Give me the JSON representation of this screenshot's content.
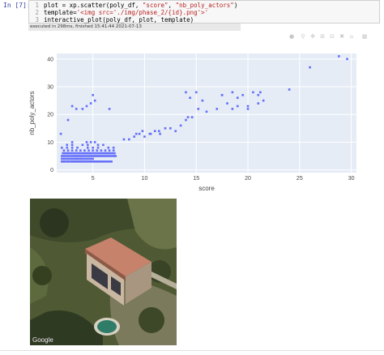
{
  "cell": {
    "prompt": "In [7]:",
    "lines": [
      {
        "num": "1",
        "parts": [
          {
            "t": "plot = xp.scatter(poly_df, ",
            "c": "tok-fn"
          },
          {
            "t": "\"score\"",
            "c": "tok-str"
          },
          {
            "t": ", ",
            "c": "tok-fn"
          },
          {
            "t": "\"nb_poly_actors\"",
            "c": "tok-str"
          },
          {
            "t": ")",
            "c": "tok-fn"
          }
        ]
      },
      {
        "num": "2",
        "parts": [
          {
            "t": "template=",
            "c": "tok-fn"
          },
          {
            "t": "'<img src='./img/phase_2/{id}.png'>'",
            "c": "tok-str"
          }
        ]
      },
      {
        "num": "3",
        "parts": [
          {
            "t": "interactive_plot(poly_df, plot, template)",
            "c": "tok-fn"
          }
        ]
      }
    ],
    "status": "executed in 298ms, finished 15:41:44 2021-07-13"
  },
  "toolbar": {
    "icons": [
      "camera-icon",
      "zoom-icon",
      "pan-icon",
      "zoom-in-icon",
      "zoom-out-icon",
      "autoscale-icon",
      "reset-axes-icon",
      "plotly-logo-icon"
    ]
  },
  "map": {
    "attribution": "Google"
  },
  "chart_data": {
    "type": "scatter",
    "xlabel": "score",
    "ylabel": "nb_poly_actors",
    "xlim": [
      1.5,
      30.5
    ],
    "ylim": [
      -1,
      42
    ],
    "xticks": [
      5,
      10,
      15,
      20,
      25,
      30
    ],
    "yticks": [
      0,
      10,
      20,
      30,
      40
    ],
    "colors": {
      "marker": "#636efa",
      "plot_bg": "#e5ecf6",
      "grid": "#ffffff"
    },
    "x": [
      2,
      2.2,
      2.4,
      2.6,
      2.8,
      3,
      3.2,
      3.4,
      3.6,
      3.8,
      4,
      4.2,
      4.4,
      4.6,
      4.8,
      5,
      5.2,
      5.4,
      5.6,
      5.8,
      6,
      6.2,
      6.4,
      6.6,
      6.8,
      2,
      2.2,
      2.4,
      2.6,
      2.8,
      3,
      3.2,
      3.4,
      3.6,
      3.8,
      4,
      4.2,
      4.4,
      4.6,
      4.8,
      5,
      2,
      2.2,
      2.4,
      2.6,
      2.8,
      3,
      3.2,
      3.4,
      3.6,
      3.8,
      4,
      4.2,
      4.4,
      4.6,
      4.8,
      5,
      5.2,
      5.4,
      5.6,
      5.8,
      6,
      6.2,
      6.4,
      6.6,
      6.8,
      7,
      7.2,
      2.1,
      2.3,
      2.5,
      2.7,
      2.9,
      3.1,
      3.3,
      3.5,
      3.7,
      3.9,
      4.1,
      4.3,
      4.5,
      4.7,
      4.9,
      5.1,
      5.3,
      5.5,
      5.7,
      5.9,
      6.1,
      6.3,
      6.5,
      6.7,
      6.9,
      7.1,
      2.2,
      2.6,
      3,
      3.4,
      3.8,
      4.2,
      4.6,
      5,
      5.4,
      5.8,
      6.2,
      6.6,
      7,
      2,
      2.5,
      3,
      3.5,
      4.5,
      5,
      5.5,
      6.5,
      7,
      2.5,
      3,
      4,
      4.5,
      5.5,
      6,
      3,
      4.4,
      4.8,
      5.2,
      1.9,
      2.6,
      3,
      3.4,
      4,
      4.4,
      4.8,
      5,
      5.2,
      6.6,
      8,
      8.5,
      9,
      9.5,
      10,
      10.5,
      11,
      11.5,
      12,
      12.5,
      13,
      13.5,
      9.2,
      9.8,
      10.6,
      11.4,
      14,
      14.2,
      14.4,
      14.6,
      15,
      15.2,
      15.6,
      14,
      16,
      17,
      17.5,
      18,
      18.5,
      19,
      19.5,
      20,
      20.5,
      21,
      21.2,
      21.5,
      17.5,
      18.5,
      19,
      20,
      21,
      24,
      26,
      28.8,
      29.6
    ],
    "y": [
      3,
      3,
      3,
      3,
      3,
      3,
      3,
      3,
      3,
      3,
      3,
      3,
      3,
      3,
      3,
      3,
      3,
      3,
      3,
      3,
      3,
      3,
      3,
      3,
      3,
      4,
      4,
      4,
      4,
      4,
      4,
      4,
      4,
      4,
      4,
      4,
      4,
      4,
      4,
      4,
      4,
      5,
      5,
      5,
      5,
      5,
      5,
      5,
      5,
      5,
      5,
      5,
      5,
      5,
      5,
      5,
      5,
      5,
      5,
      5,
      5,
      5,
      5,
      5,
      5,
      5,
      5,
      5,
      6,
      6,
      6,
      6,
      6,
      6,
      6,
      6,
      6,
      6,
      6,
      6,
      6,
      6,
      6,
      6,
      6,
      6,
      6,
      6,
      6,
      6,
      6,
      6,
      6,
      6,
      7,
      7,
      7,
      7,
      7,
      7,
      7,
      7,
      7,
      7,
      7,
      7,
      7,
      8,
      8,
      8,
      8,
      8,
      8,
      8,
      8,
      8,
      9,
      9,
      9,
      9,
      9,
      9,
      10,
      10,
      10,
      10,
      13,
      18,
      23,
      22,
      22,
      23,
      24,
      27,
      25,
      22,
      11,
      11,
      12,
      13,
      12,
      13,
      14,
      13,
      15,
      15,
      14,
      16,
      13,
      14,
      13,
      14,
      18,
      19,
      26,
      19,
      28,
      22,
      25,
      28,
      21,
      22,
      27,
      24,
      28,
      23,
      27,
      22,
      28,
      24,
      28,
      25,
      27,
      22,
      26,
      23,
      27,
      29,
      37,
      41,
      40
    ]
  }
}
